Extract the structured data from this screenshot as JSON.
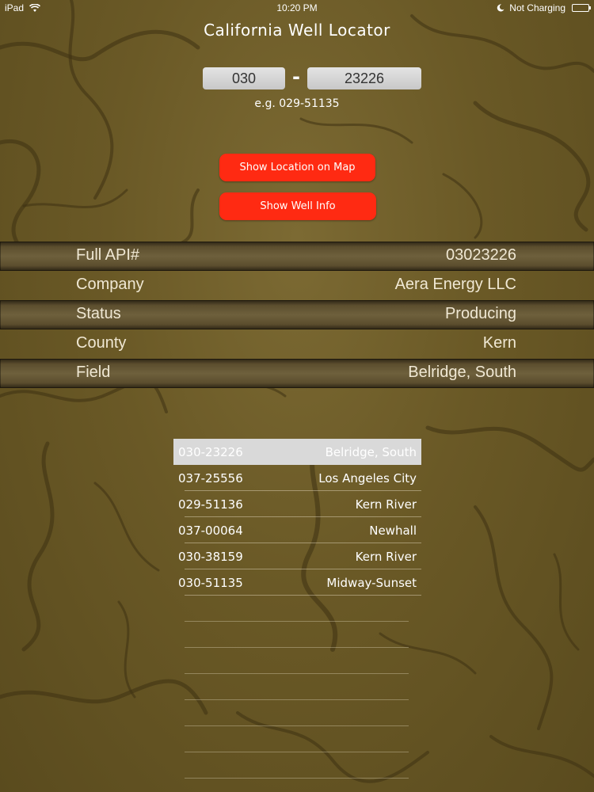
{
  "status_bar": {
    "device": "iPad",
    "time": "10:20 PM",
    "charging": "Not Charging"
  },
  "title": "California Well Locator",
  "api_entry": {
    "county_code": "030",
    "separator": "-",
    "well_number": "23226",
    "example": "e.g. 029-51135"
  },
  "buttons": {
    "show_location": "Show Location on Map",
    "show_info": "Show Well Info"
  },
  "well_info": [
    {
      "label": "Full API#",
      "value": "03023226"
    },
    {
      "label": "Company",
      "value": "Aera Energy LLC"
    },
    {
      "label": "Status",
      "value": "Producing"
    },
    {
      "label": "County",
      "value": "Kern"
    },
    {
      "label": "Field",
      "value": "Belridge, South"
    }
  ],
  "recent_wells": [
    {
      "api": "030-23226",
      "field": "Belridge, South",
      "selected": true
    },
    {
      "api": "037-25556",
      "field": "Los Angeles City"
    },
    {
      "api": "029-51136",
      "field": "Kern River"
    },
    {
      "api": "037-00064",
      "field": "Newhall"
    },
    {
      "api": "030-38159",
      "field": "Kern River"
    },
    {
      "api": "030-51135",
      "field": "Midway-Sunset"
    }
  ],
  "icons": {
    "wifi": "wifi-icon",
    "moon": "do-not-disturb-moon-icon",
    "battery": "battery-icon"
  },
  "colors": {
    "button_red": "#ff2a12",
    "background": "#6b5a26",
    "selected_row": "#d9d9d9"
  }
}
